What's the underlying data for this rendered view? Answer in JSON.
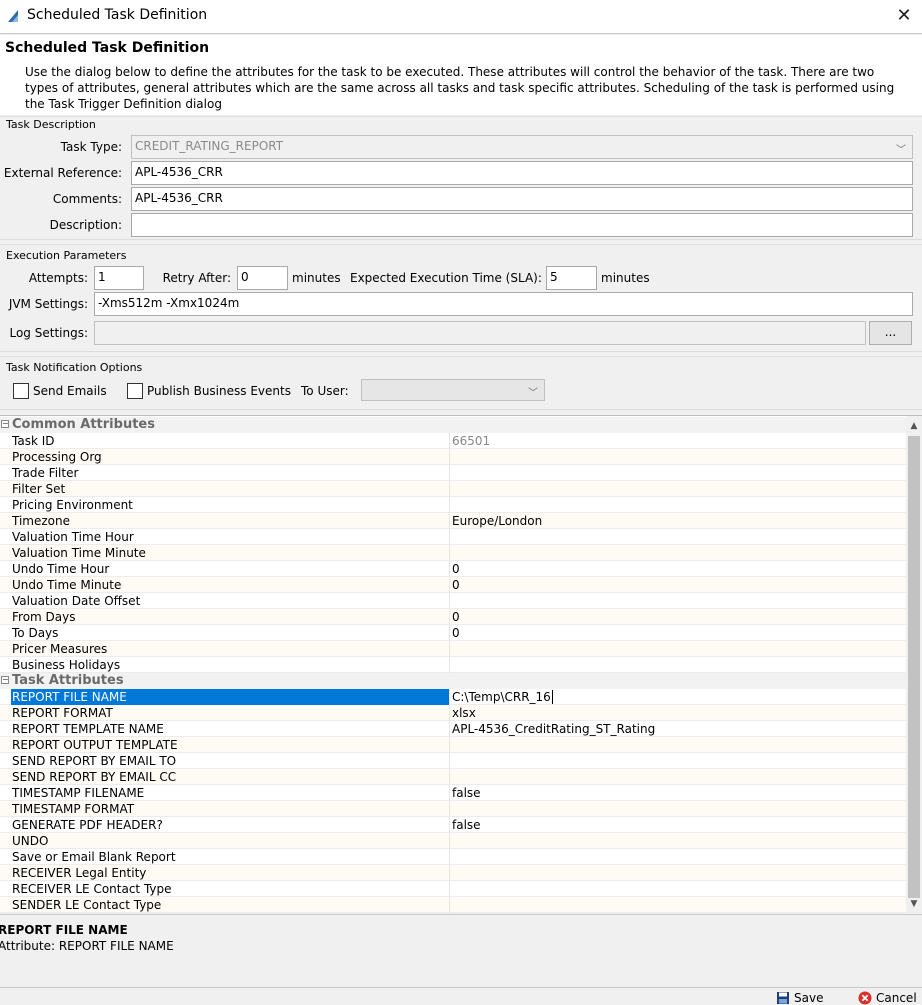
{
  "window": {
    "title": "Scheduled Task Definition"
  },
  "header": {
    "title": "Scheduled Task Definition",
    "description": "Use the dialog below to define the attributes for the task to be executed.  These attributes will control the behavior of the task.  There are two types of attributes, general attributes which are the same across all tasks and task specific attributes.  Scheduling of the task is performed using the Task Trigger Definition dialog"
  },
  "task_description": {
    "group_label": "Task Description",
    "task_type_label": "Task Type:",
    "task_type_value": "CREDIT_RATING_REPORT",
    "external_reference_label": "External Reference:",
    "external_reference_value": "APL-4536_CRR",
    "comments_label": "Comments:",
    "comments_value": "APL-4536_CRR",
    "description_label": "Description:",
    "description_value": ""
  },
  "execution": {
    "group_label": "Execution Parameters",
    "attempts_label": "Attempts:",
    "attempts_value": "1",
    "retry_label": "Retry After:",
    "retry_value": "0",
    "retry_unit": "minutes",
    "sla_label": "Expected Execution Time (SLA):",
    "sla_value": "5",
    "sla_unit": "minutes",
    "jvm_label": "JVM Settings:",
    "jvm_value": "-Xms512m -Xmx1024m",
    "log_label": "Log Settings:",
    "log_value": "",
    "log_button": "..."
  },
  "notification": {
    "group_label": "Task Notification Options",
    "send_emails_label": "Send Emails",
    "publish_label": "Publish Business Events",
    "to_user_label": "To User:",
    "to_user_value": ""
  },
  "common_attributes": {
    "title": "Common Attributes",
    "rows": [
      {
        "k": "Task ID",
        "v": "66501"
      },
      {
        "k": "Processing Org",
        "v": ""
      },
      {
        "k": "Trade Filter",
        "v": ""
      },
      {
        "k": "Filter Set",
        "v": ""
      },
      {
        "k": "Pricing Environment",
        "v": ""
      },
      {
        "k": "Timezone",
        "v": "Europe/London"
      },
      {
        "k": "Valuation Time Hour",
        "v": ""
      },
      {
        "k": "Valuation Time Minute",
        "v": ""
      },
      {
        "k": "Undo Time Hour",
        "v": "0"
      },
      {
        "k": "Undo Time Minute",
        "v": "0"
      },
      {
        "k": "Valuation Date Offset",
        "v": ""
      },
      {
        "k": "From Days",
        "v": "0"
      },
      {
        "k": "To Days",
        "v": "0"
      },
      {
        "k": "Pricer Measures",
        "v": ""
      },
      {
        "k": "Business Holidays",
        "v": ""
      }
    ]
  },
  "task_attributes": {
    "title": "Task Attributes",
    "rows": [
      {
        "k": "REPORT FILE NAME",
        "v": "C:\\Temp\\CRR_16"
      },
      {
        "k": "REPORT FORMAT",
        "v": "xlsx"
      },
      {
        "k": "REPORT TEMPLATE NAME",
        "v": "APL-4536_CreditRating_ST_Rating"
      },
      {
        "k": "REPORT OUTPUT TEMPLATE",
        "v": ""
      },
      {
        "k": "SEND REPORT BY EMAIL TO",
        "v": ""
      },
      {
        "k": "SEND REPORT BY EMAIL CC",
        "v": ""
      },
      {
        "k": "TIMESTAMP FILENAME",
        "v": "false"
      },
      {
        "k": "TIMESTAMP FORMAT",
        "v": ""
      },
      {
        "k": "GENERATE PDF HEADER?",
        "v": "false"
      },
      {
        "k": "UNDO",
        "v": ""
      },
      {
        "k": "Save or Email Blank Report",
        "v": ""
      },
      {
        "k": "RECEIVER Legal Entity",
        "v": ""
      },
      {
        "k": "RECEIVER LE Contact Type",
        "v": ""
      },
      {
        "k": "SENDER LE Contact Type",
        "v": ""
      }
    ]
  },
  "info": {
    "title": "REPORT FILE NAME",
    "description": "Attribute: REPORT FILE NAME"
  },
  "footer": {
    "save_label": "Save",
    "cancel_label": "Cancel"
  },
  "colors": {
    "selection": "#0078d7",
    "cancel_icon": "#d9302c",
    "save_icon": "#1e3f7a"
  }
}
